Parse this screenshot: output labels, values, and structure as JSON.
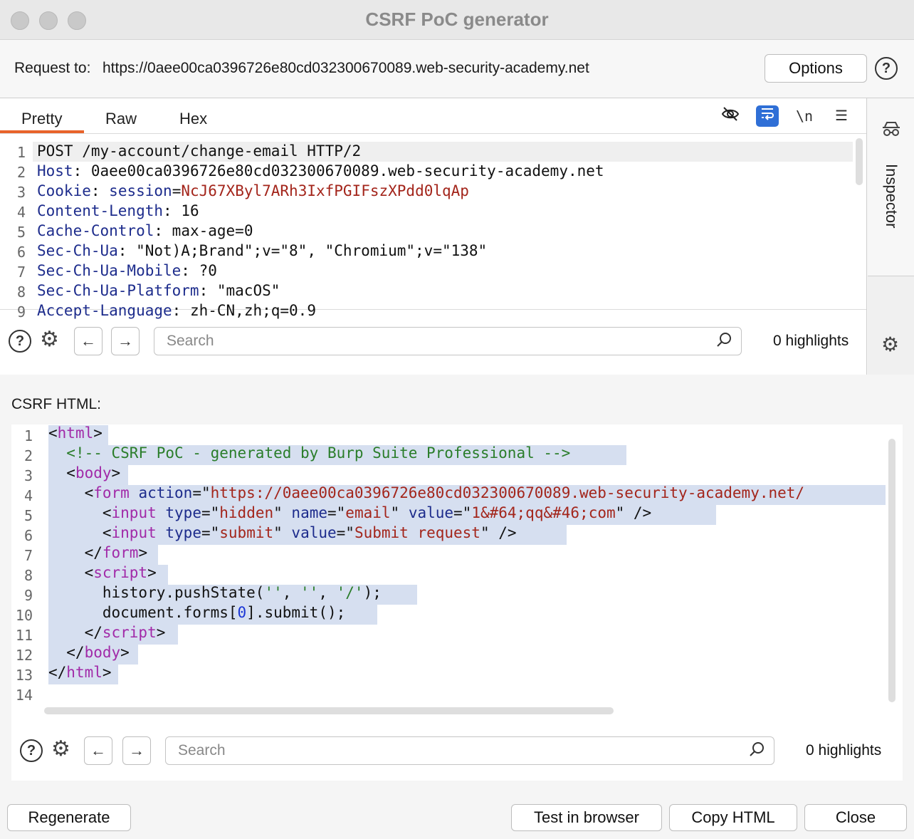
{
  "window": {
    "title": "CSRF PoC generator"
  },
  "request": {
    "label": "Request to:",
    "url": "https://0aee00ca0396726e80cd032300670089.web-security-academy.net",
    "options_label": "Options",
    "help": "?"
  },
  "request_editor": {
    "tabs": [
      "Pretty",
      "Raw",
      "Hex"
    ],
    "active_tab": "Pretty",
    "toolbar_icons": [
      "hide-icon",
      "wrap-icon",
      "newline-icon",
      "menu-icon"
    ],
    "newline_label": "\\n",
    "lines": [
      {
        "num": "1",
        "name": "",
        "sep": "",
        "value": "POST /my-account/change-email HTTP/2"
      },
      {
        "num": "2",
        "name": "Host",
        "sep": ":",
        "value": " 0aee00ca0396726e80cd032300670089.web-security-academy.net"
      },
      {
        "num": "3",
        "name": "Cookie",
        "sep": ":",
        "value": ""
      },
      {
        "num": "4",
        "name": "Content-Length",
        "sep": ":",
        "value": " 16"
      },
      {
        "num": "5",
        "name": "Cache-Control",
        "sep": ":",
        "value": " max-age=0"
      },
      {
        "num": "6",
        "name": "Sec-Ch-Ua",
        "sep": ":",
        "value": " \"Not)A;Brand\";v=\"8\", \"Chromium\";v=\"138\""
      },
      {
        "num": "7",
        "name": "Sec-Ch-Ua-Mobile",
        "sep": ":",
        "value": " ?0"
      },
      {
        "num": "8",
        "name": "Sec-Ch-Ua-Platform",
        "sep": ":",
        "value": " \"macOS\""
      },
      {
        "num": "9",
        "name": "Accept-Language",
        "sep": ":",
        "value": " zh-CN,zh;q=0.9"
      }
    ],
    "cookie": {
      "key": "session",
      "eq": "=",
      "value": "NcJ67XByl7ARh3IxfPGIFszXPdd0lqAp"
    },
    "search_placeholder": "Search",
    "highlights": "0 highlights"
  },
  "inspector": {
    "label": "Inspector"
  },
  "csrf": {
    "label": "CSRF HTML:",
    "line_numbers": [
      "1",
      "2",
      "3",
      "4",
      "5",
      "6",
      "7",
      "8",
      "9",
      "10",
      "11",
      "12",
      "13",
      "14"
    ],
    "search_placeholder": "Search",
    "highlights": "0 highlights"
  },
  "footer": {
    "regenerate": "Regenerate",
    "test_in_browser": "Test in browser",
    "copy_html": "Copy HTML",
    "close": "Close"
  },
  "colors": {
    "accent_tab": "#e8632a",
    "active_icon": "#2f6fd6",
    "selection": "#d6dff0"
  }
}
